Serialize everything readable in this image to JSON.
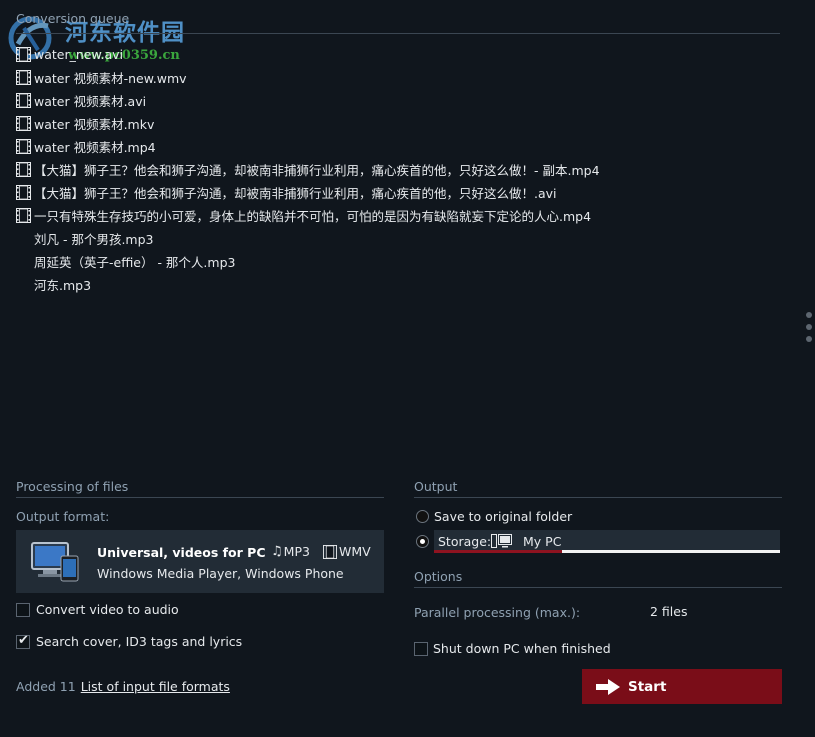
{
  "watermark": {
    "site_name": "河东软件园",
    "url": "www.pc0359.cn"
  },
  "queue": {
    "title": "Conversion queue",
    "video_items": [
      "water_new.avi",
      "water 视频素材-new.wmv",
      "water 视频素材.avi",
      "water 视频素材.mkv",
      "water 视频素材.mp4",
      "【大猫】狮子王？他会和狮子沟通，却被南非捕狮行业利用，痛心疾首的他，只好这么做！- 副本.mp4",
      "【大猫】狮子王？他会和狮子沟通，却被南非捕狮行业利用，痛心疾首的他，只好这么做！.avi",
      "一只有特殊生存技巧的小可爱，身体上的缺陷并不可怕，可怕的是因为有缺陷就妄下定论的人心.mp4"
    ],
    "audio_items": [
      "刘凡 - 那个男孩.mp3",
      "周延英（英子-effie） - 那个人.mp3",
      "河东.mp3"
    ]
  },
  "processing": {
    "title": "Processing of files",
    "output_format_label": "Output format:",
    "format": {
      "name": "Universal, videos for PC",
      "audio_tag": "MP3",
      "video_tag": "WMV",
      "description": "Windows Media Player, Windows Phone"
    },
    "convert_audio": {
      "label": "Convert video to audio",
      "checked": false
    },
    "search_cover": {
      "label": "Search cover, ID3 tags and lyrics",
      "checked": true
    },
    "added_label": "Added 11",
    "formats_link": "List of input file formats"
  },
  "output": {
    "title": "Output",
    "save_original": {
      "label": "Save to original folder",
      "selected": false
    },
    "storage": {
      "label": "Storage:",
      "value": "My PC",
      "selected": true,
      "fill_fraction": 0.37
    }
  },
  "options": {
    "title": "Options",
    "parallel_label": "Parallel processing (max.):",
    "parallel_value": "2 files",
    "shutdown": {
      "label": "Shut down PC when finished",
      "checked": false
    }
  },
  "start_button": {
    "label": "Start"
  },
  "colors": {
    "accent": "#7a0d18",
    "background": "#10161d",
    "panel": "#222c36"
  }
}
